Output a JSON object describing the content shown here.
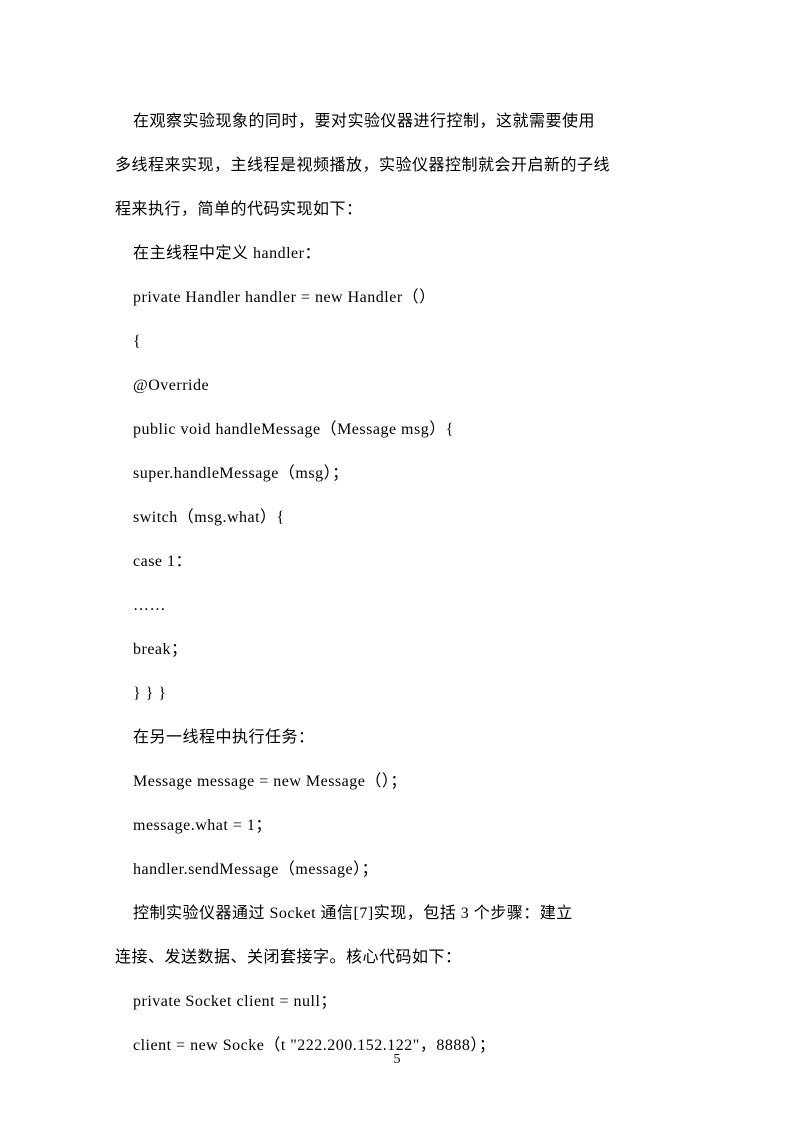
{
  "lines": [
    "    在观察实验现象的同时，要对实验仪器进行控制，这就需要使用",
    "多线程来实现，主线程是视频播放，实验仪器控制就会开启新的子线",
    "程来执行，简单的代码实现如下：",
    "    在主线程中定义 handler：",
    "    private Handler handler = new Handler（）",
    "    {",
    "    @Override",
    "    public void handleMessage（Message msg）{",
    "    super.handleMessage（msg）；",
    "    switch（msg.what）{",
    "    case 1：",
    "    ……",
    "    break；",
    "    } } }",
    "    在另一线程中执行任务：",
    "    Message message = new Message（）；",
    "    message.what = 1；",
    "    handler.sendMessage（message）；",
    "    控制实验仪器通过 Socket 通信[7]实现，包括 3 个步骤：建立",
    "连接、发送数据、关闭套接字。核心代码如下：",
    "    private Socket client = null；",
    "    client = new Socke（t \"222.200.152.122\"，8888）；"
  ],
  "pageNumber": "5"
}
